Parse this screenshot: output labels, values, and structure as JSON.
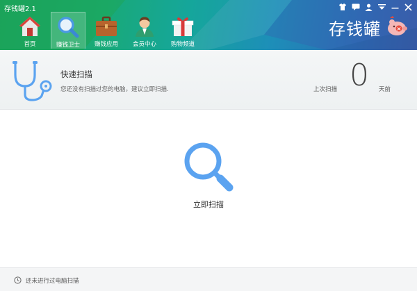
{
  "window": {
    "title": "存钱罐2.1"
  },
  "colors": {
    "accent": "#5ba3f0",
    "header_green": "#1aa86a",
    "header_blue": "#2b6fb5"
  },
  "nav": {
    "items": [
      {
        "label": "首页",
        "icon": "home-icon"
      },
      {
        "label": "赚钱卫士",
        "icon": "search-icon",
        "active": true
      },
      {
        "label": "赚钱应用",
        "icon": "briefcase-icon"
      },
      {
        "label": "会员中心",
        "icon": "user-icon"
      },
      {
        "label": "购物频道",
        "icon": "gift-icon"
      }
    ]
  },
  "brand": {
    "text": "存钱罐",
    "icon": "piggy-bank-icon"
  },
  "window_controls": [
    "skin-icon",
    "message-icon",
    "user-icon",
    "menu-icon",
    "minimize-icon",
    "close-icon"
  ],
  "scan": {
    "title": "快速扫描",
    "description": "您还没有扫描过您的电脑，建议立即扫描.",
    "last_scan_label": "上次扫描",
    "days_value": "0",
    "days_unit": "天前",
    "button_label": "立即扫描"
  },
  "footer": {
    "status": "还未进行过电脑扫描"
  }
}
